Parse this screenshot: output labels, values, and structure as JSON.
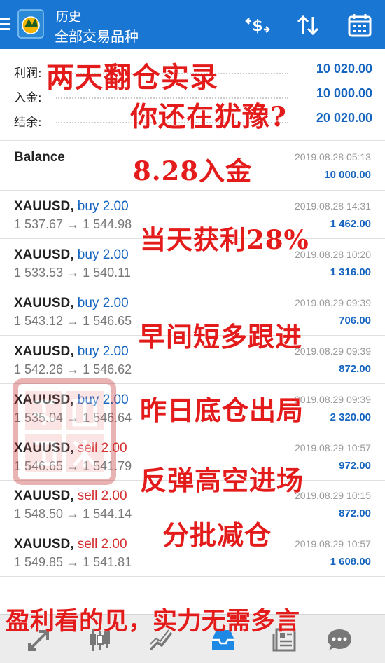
{
  "header": {
    "title": "历史",
    "subtitle": "全部交易品种",
    "icons": [
      "menu-icon",
      "metatrader-logo",
      "currency-exchange-icon",
      "sort-icon",
      "calendar-icon"
    ]
  },
  "summary": {
    "profit_label": "利润:",
    "profit_value": "10 020.00",
    "deposit_label": "入金:",
    "deposit_value": "10 000.00",
    "balance_label": "结余:",
    "balance_value": "20 020.00"
  },
  "balance_row": {
    "label": "Balance",
    "date": "2019.08.28 05:13",
    "amount": "10 000.00"
  },
  "trades": [
    {
      "symbol": "XAUUSD,",
      "type": "buy 2.00",
      "side": "buy",
      "prices": "1 537.67 → 1 544.98",
      "date": "2019.08.28 14:31",
      "profit": "1 462.00"
    },
    {
      "symbol": "XAUUSD,",
      "type": "buy 2.00",
      "side": "buy",
      "prices": "1 533.53 → 1 540.11",
      "date": "2019.08.28 10:20",
      "profit": "1 316.00"
    },
    {
      "symbol": "XAUUSD,",
      "type": "buy 2.00",
      "side": "buy",
      "prices": "1 543.12 → 1 546.65",
      "date": "2019.08.29 09:39",
      "profit": "706.00"
    },
    {
      "symbol": "XAUUSD,",
      "type": "buy 2.00",
      "side": "buy",
      "prices": "1 542.26 → 1 546.62",
      "date": "2019.08.29 09:39",
      "profit": "872.00"
    },
    {
      "symbol": "XAUUSD,",
      "type": "buy 2.00",
      "side": "buy",
      "prices": "1 535.04 → 1 546.64",
      "date": "2019.08.29 09:39",
      "profit": "2 320.00"
    },
    {
      "symbol": "XAUUSD,",
      "type": "sell 2.00",
      "side": "sell",
      "prices": "1 546.65 → 1 541.79",
      "date": "2019.08.29 10:57",
      "profit": "972.00"
    },
    {
      "symbol": "XAUUSD,",
      "type": "sell 2.00",
      "side": "sell",
      "prices": "1 548.50 → 1 544.14",
      "date": "2019.08.29 10:15",
      "profit": "872.00"
    },
    {
      "symbol": "XAUUSD,",
      "type": "sell 2.00",
      "side": "sell",
      "prices": "1 549.85 → 1 541.81",
      "date": "2019.08.29 10:57",
      "profit": "1 608.00"
    }
  ],
  "captions": {
    "c1": "两天翻仓实录",
    "c2": "你还在犹豫?",
    "c3": "8.28入金",
    "c4": "当天获利28%",
    "c5": "早间短多跟进",
    "c6": "昨日底仓出局",
    "c7": "反弹高空进场",
    "c8": "分批减仓",
    "c9": "盈利看的见，实力无需多言"
  },
  "bottom_nav": [
    "quotes-icon",
    "chart-icon",
    "trade-icon",
    "history-icon",
    "news-icon",
    "chat-icon"
  ],
  "colors": {
    "header": "#1976d2",
    "value_blue": "#1565c0",
    "sell_red": "#d32f2f",
    "caption_red": "#e41b1b"
  }
}
